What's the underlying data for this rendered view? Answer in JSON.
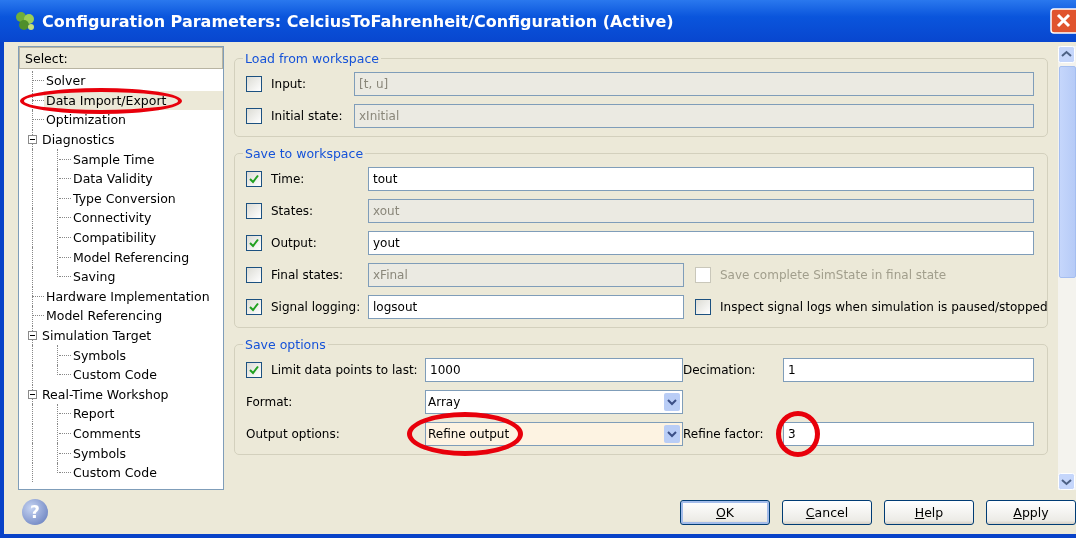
{
  "window": {
    "title": "Configuration Parameters: CelciusToFahrenheit/Configuration (Active)"
  },
  "tree": {
    "header": "Select:",
    "items": [
      {
        "label": "Solver",
        "selected": false
      },
      {
        "label": "Data Import/Export",
        "selected": true,
        "circled": true
      },
      {
        "label": "Optimization",
        "selected": false
      },
      {
        "label": "Diagnostics",
        "selected": false,
        "expanded": true,
        "children": [
          {
            "label": "Sample Time",
            "selected": false
          },
          {
            "label": "Data Validity",
            "selected": false
          },
          {
            "label": "Type Conversion",
            "selected": false
          },
          {
            "label": "Connectivity",
            "selected": false
          },
          {
            "label": "Compatibility",
            "selected": false
          },
          {
            "label": "Model Referencing",
            "selected": false
          },
          {
            "label": "Saving",
            "selected": false
          }
        ]
      },
      {
        "label": "Hardware Implementation",
        "selected": false
      },
      {
        "label": "Model Referencing",
        "selected": false
      },
      {
        "label": "Simulation Target",
        "selected": false,
        "expanded": true,
        "children": [
          {
            "label": "Symbols",
            "selected": false
          },
          {
            "label": "Custom Code",
            "selected": false
          }
        ]
      },
      {
        "label": "Real-Time Workshop",
        "selected": false,
        "expanded": true,
        "children": [
          {
            "label": "Report",
            "selected": false
          },
          {
            "label": "Comments",
            "selected": false
          },
          {
            "label": "Symbols",
            "selected": false
          },
          {
            "label": "Custom Code",
            "selected": false
          }
        ]
      }
    ]
  },
  "sections": [
    {
      "kind": "load",
      "title": "Load from workspace",
      "rows": [
        {
          "cells": [
            {
              "kind": "checkbox",
              "label": "Input:",
              "checked": false,
              "disabled": false
            },
            {
              "kind": "input",
              "value": "[t, u]",
              "disabled": true
            }
          ]
        },
        {
          "cells": [
            {
              "kind": "checkbox",
              "label": "Initial state:",
              "checked": false,
              "disabled": false
            },
            {
              "kind": "input",
              "value": "xInitial",
              "disabled": true
            }
          ]
        }
      ]
    },
    {
      "kind": "save",
      "title": "Save to workspace",
      "rows": [
        {
          "cells": [
            {
              "kind": "checkbox",
              "label": "Time:",
              "checked": true,
              "disabled": false
            },
            {
              "kind": "input",
              "value": "tout",
              "disabled": false
            }
          ]
        },
        {
          "cells": [
            {
              "kind": "checkbox",
              "label": "States:",
              "checked": false,
              "disabled": false
            },
            {
              "kind": "input",
              "value": "xout",
              "disabled": true
            }
          ]
        },
        {
          "cells": [
            {
              "kind": "checkbox",
              "label": "Output:",
              "checked": true,
              "disabled": false
            },
            {
              "kind": "input",
              "value": "yout",
              "disabled": false
            }
          ]
        },
        {
          "cells": [
            {
              "kind": "checkbox",
              "label": "Final states:",
              "checked": false,
              "disabled": false
            },
            {
              "kind": "input",
              "value": "xFinal",
              "disabled": true
            },
            {
              "kind": "checkbox",
              "label": "Save complete SimState in final state",
              "checked": false,
              "disabled": true
            }
          ]
        },
        {
          "cells": [
            {
              "kind": "checkbox",
              "label": "Signal logging:",
              "checked": true,
              "disabled": false
            },
            {
              "kind": "input",
              "value": "logsout",
              "disabled": false
            },
            {
              "kind": "checkbox",
              "label": "Inspect signal logs when simulation is paused/stopped",
              "checked": false,
              "disabled": false
            }
          ]
        }
      ]
    },
    {
      "kind": "options",
      "title": "Save options",
      "rows": [
        {
          "cells": [
            {
              "kind": "checkbox",
              "label": "Limit data points to last:",
              "checked": true,
              "disabled": false
            },
            {
              "kind": "input",
              "value": "1000",
              "disabled": false
            },
            {
              "kind": "label",
              "text": "Decimation:"
            },
            {
              "kind": "input",
              "value": "1",
              "disabled": false
            }
          ]
        },
        {
          "cells": [
            {
              "kind": "label",
              "text": "Format:"
            },
            {
              "kind": "select",
              "value": "Array",
              "highlighted": false
            }
          ]
        },
        {
          "cells": [
            {
              "kind": "label",
              "text": "Output options:"
            },
            {
              "kind": "select",
              "value": "Refine output",
              "highlighted": true,
              "circled": true
            },
            {
              "kind": "label",
              "text": "Refine factor:"
            },
            {
              "kind": "input",
              "value": "3",
              "disabled": false,
              "circled": true
            }
          ]
        }
      ]
    }
  ],
  "help_icon": "?",
  "buttons": [
    {
      "label": "OK",
      "default": true
    },
    {
      "label": "Cancel",
      "default": false
    },
    {
      "label": "Help",
      "default": false
    },
    {
      "label": "Apply",
      "default": false
    }
  ]
}
